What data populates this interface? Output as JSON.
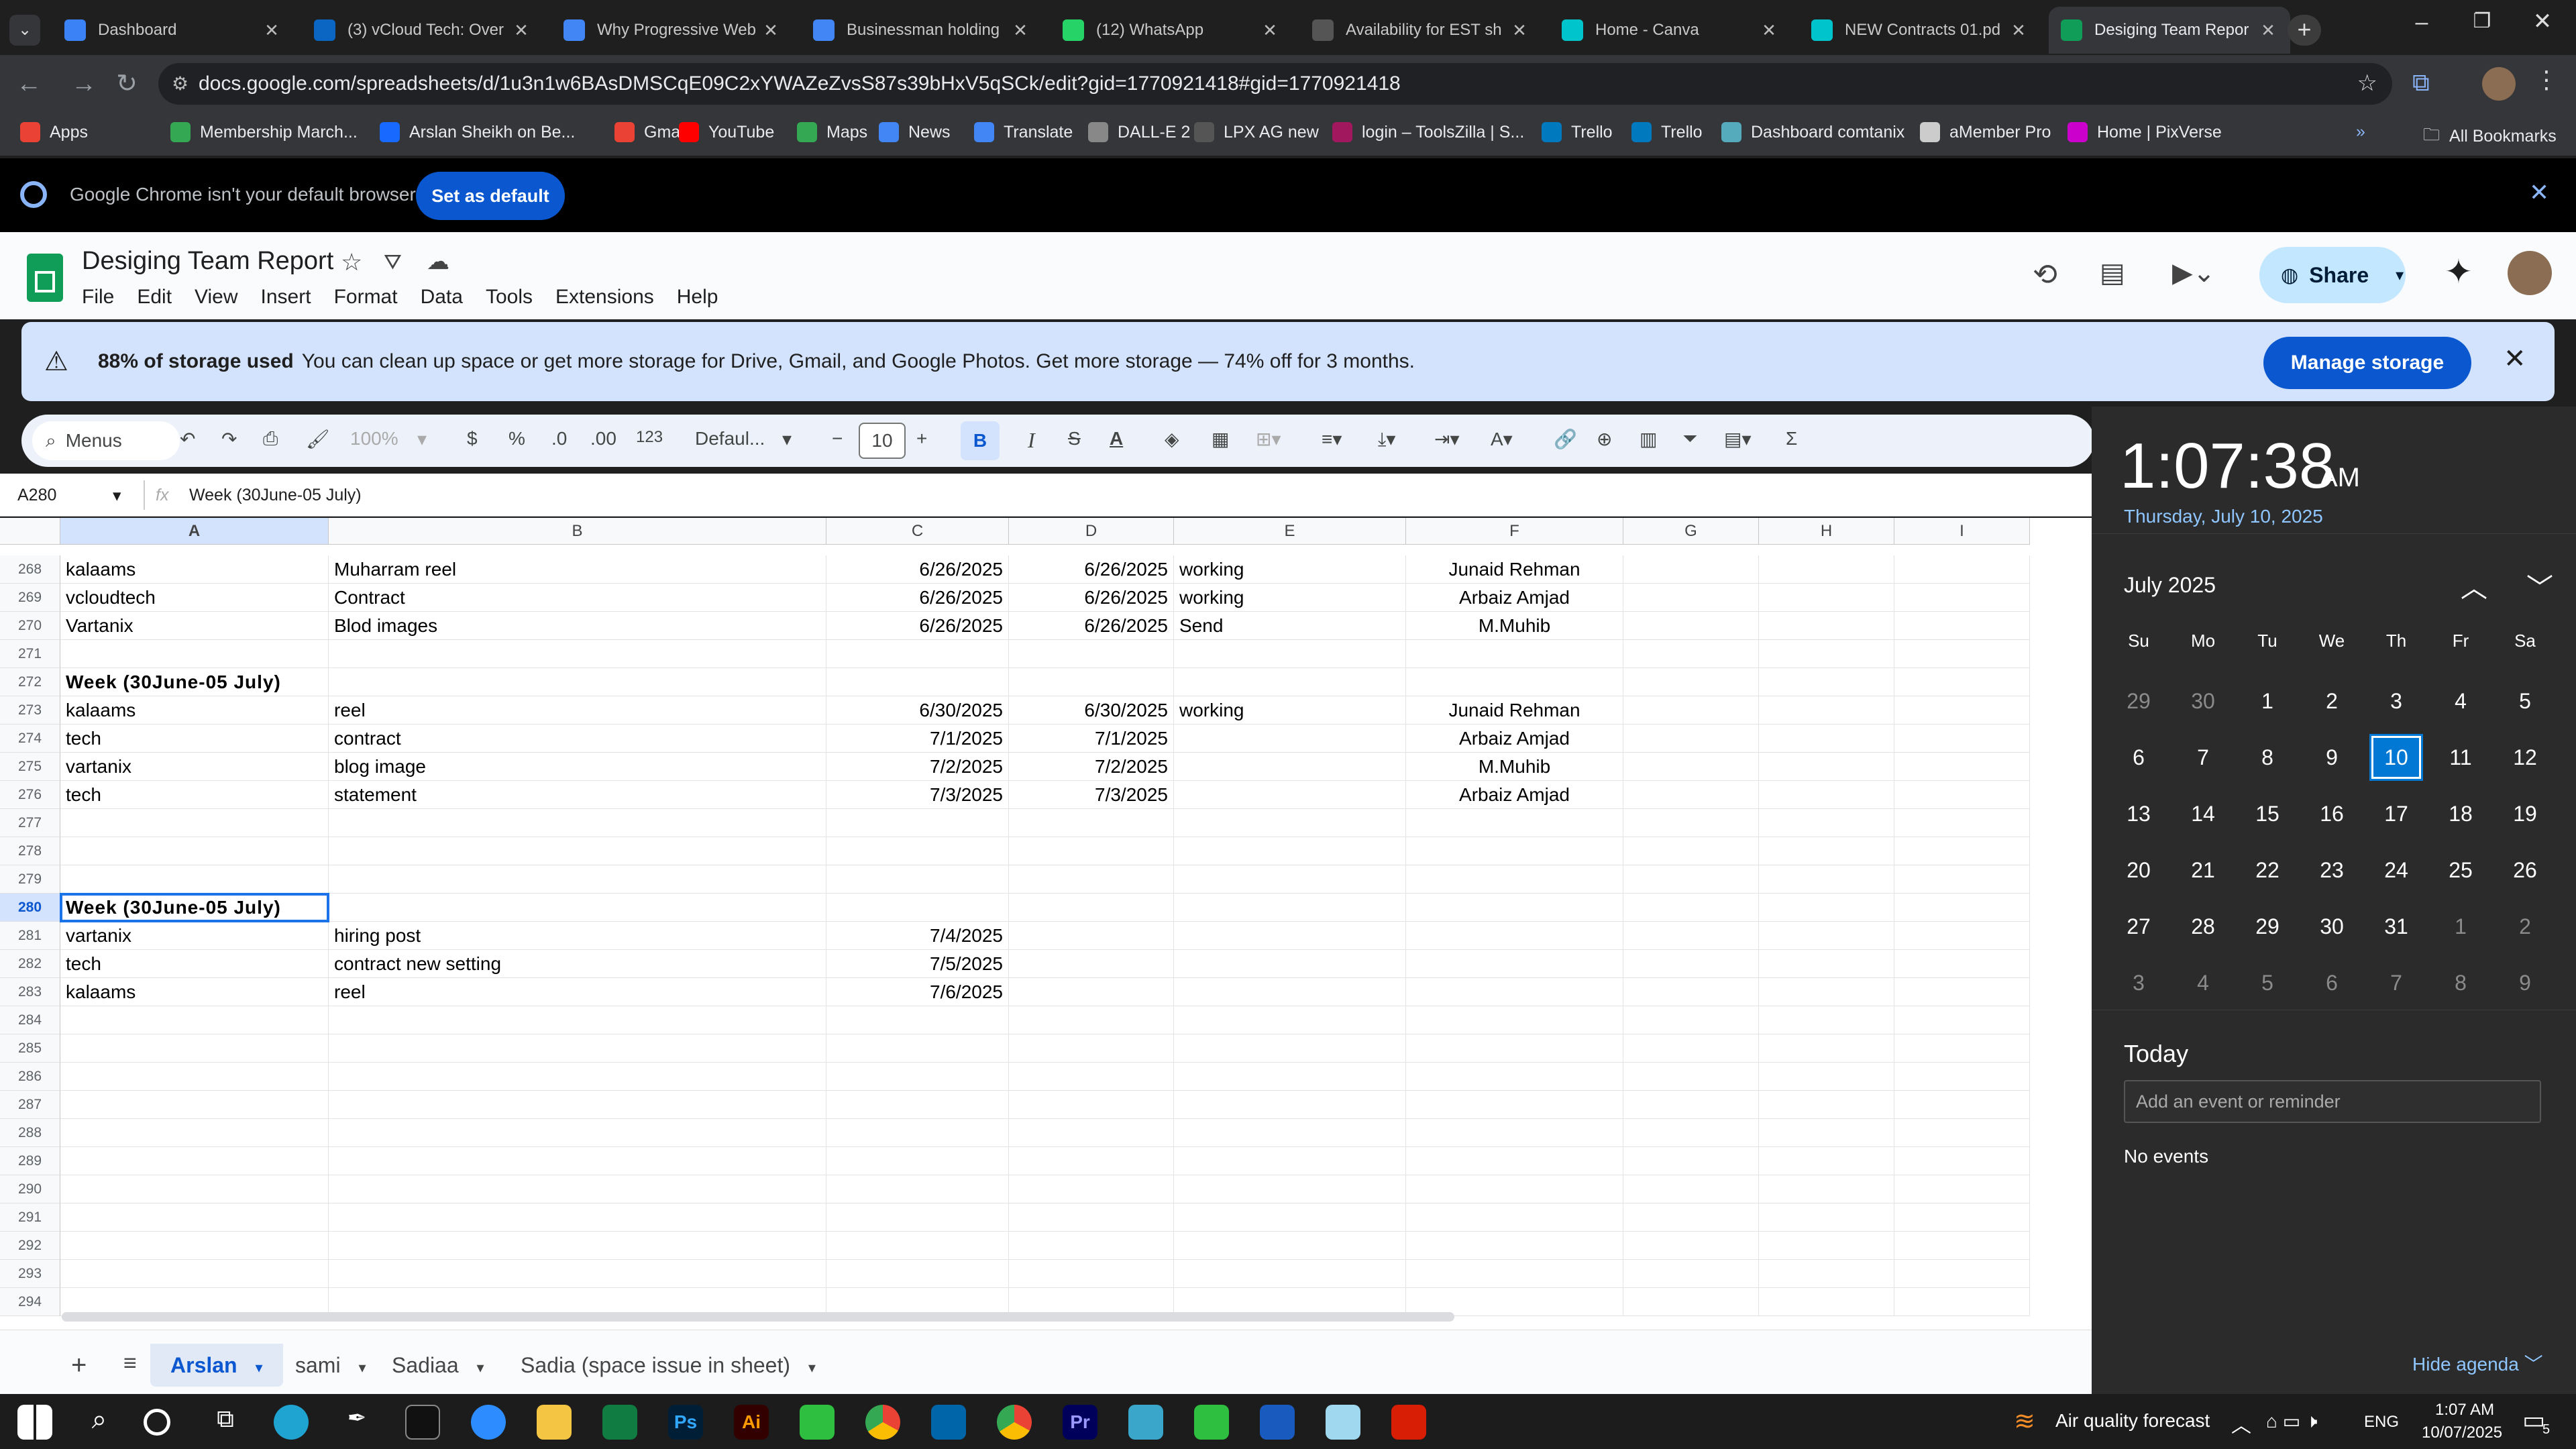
{
  "tabs": [
    {
      "label": "Dashboard",
      "color": "#3b82f6"
    },
    {
      "label": "(3) vCloud Tech: Over",
      "color": "#0a66c2"
    },
    {
      "label": "Why Progressive Web",
      "color": "#4285f4"
    },
    {
      "label": "Businessman holding",
      "color": "#4285f4"
    },
    {
      "label": "(12) WhatsApp",
      "color": "#25d366"
    },
    {
      "label": "Availability for EST sh",
      "color": "#555555"
    },
    {
      "label": "Home - Canva",
      "color": "#00c4cc"
    },
    {
      "label": "NEW Contracts 01.pd",
      "color": "#00c4cc"
    },
    {
      "label": "Desiging Team Repor",
      "color": "#0f9d58"
    }
  ],
  "url": "docs.google.com/spreadsheets/d/1u3n1w6BAsDMSCqE09C2xYWAZeZvsS87s39bHxV5qSCk/edit?gid=1770921418#gid=1770921418",
  "bookmarks": [
    "Apps",
    "Membership March...",
    "Arslan Sheikh on Be...",
    "Gmail",
    "YouTube",
    "Maps",
    "News",
    "Translate",
    "DALL-E 2",
    "LPX AG new",
    "login – ToolsZilla | S...",
    "Trello",
    "Trello",
    "Dashboard comtanix",
    "aMember Pro",
    "Home | PixVerse"
  ],
  "all_bookmarks": "All Bookmarks",
  "infobar": {
    "text": "Google Chrome isn't your default browser",
    "button": "Set as default"
  },
  "doc": {
    "title": "Desiging Team Report",
    "menus": [
      "File",
      "Edit",
      "View",
      "Insert",
      "Format",
      "Data",
      "Tools",
      "Extensions",
      "Help"
    ],
    "share": "Share"
  },
  "storage": {
    "bold": "88% of storage used",
    "text": "You can clean up space or get more storage for Drive, Gmail, and Google Photos. Get more storage — 74% off for 3 months.",
    "button": "Manage storage"
  },
  "toolbar": {
    "menus": "Menus",
    "zoom": "100%",
    "currency": "$",
    "percent": "%",
    "dec_minus": ".0",
    "dec_plus": ".00",
    "num": "123",
    "font": "Defaul...",
    "size": "10"
  },
  "formula": {
    "ref": "A280",
    "fx": "fx",
    "value": "Week (30June-05 July)"
  },
  "columns": [
    "A",
    "B",
    "C",
    "D",
    "E",
    "F",
    "G",
    "H",
    "I"
  ],
  "rows": [
    {
      "n": "268",
      "a": "kalaams",
      "b": "Muharram reel",
      "c": "6/26/2025",
      "d": "6/26/2025",
      "e": "working",
      "f": "Junaid Rehman"
    },
    {
      "n": "269",
      "a": "vcloudtech",
      "b": "Contract",
      "c": "6/26/2025",
      "d": "6/26/2025",
      "e": "working",
      "f": "Arbaiz Amjad"
    },
    {
      "n": "270",
      "a": "Vartanix",
      "b": "Blod images",
      "c": "6/26/2025",
      "d": "6/26/2025",
      "e": "Send",
      "f": "M.Muhib"
    },
    {
      "n": "271",
      "a": "",
      "b": "",
      "c": "",
      "d": "",
      "e": "",
      "f": ""
    },
    {
      "n": "272",
      "a": "Week (30June-05 July)",
      "b": "",
      "c": "",
      "d": "",
      "e": "",
      "f": "",
      "bold": true
    },
    {
      "n": "273",
      "a": "kalaams",
      "b": "reel",
      "c": "6/30/2025",
      "d": "6/30/2025",
      "e": "working",
      "f": "Junaid Rehman"
    },
    {
      "n": "274",
      "a": "tech",
      "b": "contract",
      "c": "7/1/2025",
      "d": "7/1/2025",
      "e": "",
      "f": "Arbaiz Amjad"
    },
    {
      "n": "275",
      "a": "vartanix",
      "b": "blog image",
      "c": "7/2/2025",
      "d": "7/2/2025",
      "e": "",
      "f": "M.Muhib"
    },
    {
      "n": "276",
      "a": "tech",
      "b": "statement",
      "c": "7/3/2025",
      "d": "7/3/2025",
      "e": "",
      "f": "Arbaiz Amjad"
    },
    {
      "n": "277",
      "a": "",
      "b": "",
      "c": "",
      "d": "",
      "e": "",
      "f": ""
    },
    {
      "n": "278",
      "a": "",
      "b": "",
      "c": "",
      "d": "",
      "e": "",
      "f": ""
    },
    {
      "n": "279",
      "a": "",
      "b": "",
      "c": "",
      "d": "",
      "e": "",
      "f": ""
    },
    {
      "n": "280",
      "a": "Week (30June-05 July)",
      "b": "",
      "c": "",
      "d": "",
      "e": "",
      "f": "",
      "bold": true,
      "selected": true
    },
    {
      "n": "281",
      "a": "vartanix",
      "b": "hiring post",
      "c": "7/4/2025",
      "d": "",
      "e": "",
      "f": ""
    },
    {
      "n": "282",
      "a": "tech",
      "b": "contract new setting",
      "c": "7/5/2025",
      "d": "",
      "e": "",
      "f": ""
    },
    {
      "n": "283",
      "a": "kalaams",
      "b": "reel",
      "c": "7/6/2025",
      "d": "",
      "e": "",
      "f": ""
    },
    {
      "n": "284"
    },
    {
      "n": "285"
    },
    {
      "n": "286"
    },
    {
      "n": "287"
    },
    {
      "n": "288"
    },
    {
      "n": "289"
    },
    {
      "n": "290"
    },
    {
      "n": "291"
    },
    {
      "n": "292"
    },
    {
      "n": "293"
    },
    {
      "n": "294"
    }
  ],
  "sheets": [
    "Arslan",
    "sami",
    "Sadiaa",
    "Sadia (space issue in sheet)"
  ],
  "clock": {
    "time": "1:07:38",
    "ampm": "AM",
    "date": "Thursday, July 10, 2025",
    "month": "July 2025",
    "weekdays": [
      "Su",
      "Mo",
      "Tu",
      "We",
      "Th",
      "Fr",
      "Sa"
    ],
    "days": [
      "29",
      "30",
      "1",
      "2",
      "3",
      "4",
      "5",
      "6",
      "7",
      "8",
      "9",
      "10",
      "11",
      "12",
      "13",
      "14",
      "15",
      "16",
      "17",
      "18",
      "19",
      "20",
      "21",
      "22",
      "23",
      "24",
      "25",
      "26",
      "27",
      "28",
      "29",
      "30",
      "31",
      "1",
      "2",
      "3",
      "4",
      "5",
      "6",
      "7",
      "8",
      "9"
    ],
    "today_label": "Today",
    "event_placeholder": "Add an event or reminder",
    "no_events": "No events",
    "hide_agenda": "Hide agenda"
  },
  "taskbar": {
    "weather": "Air quality forecast",
    "lang": "ENG",
    "time": "1:07 AM",
    "date": "10/07/2025",
    "notif": "5"
  }
}
